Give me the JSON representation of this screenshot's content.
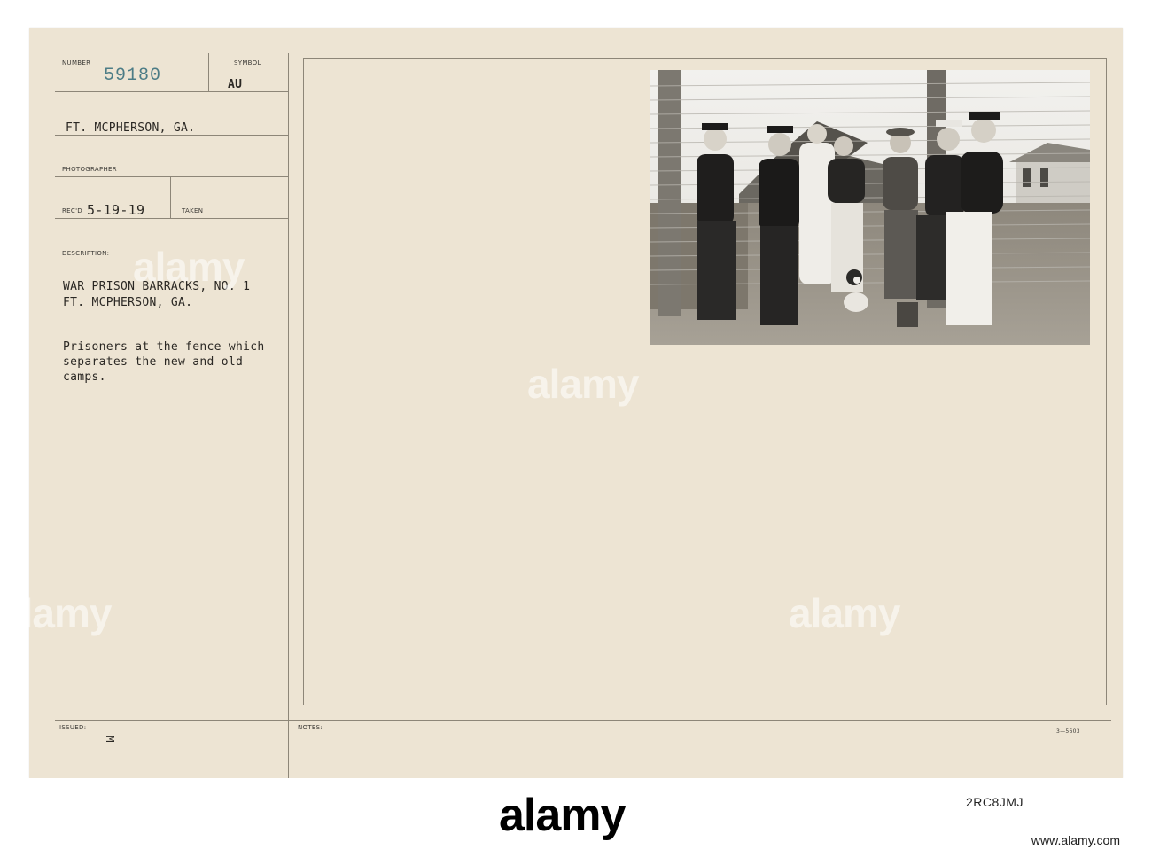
{
  "card": {
    "number_label": "NUMBER",
    "number_value": "59180",
    "symbol_label": "SYMBOL",
    "symbol_value": "AU",
    "location": "FT. MCPHERSON, GA.",
    "photographer_label": "PHOTOGRAPHER",
    "recd_label": "REC'D",
    "recd_value": "5-19-19",
    "taken_label": "TAKEN",
    "description_label": "DESCRIPTION:",
    "description_lines": [
      "WAR PRISON BARRACKS, NO. 1",
      "FT. MCPHERSON, GA."
    ],
    "caption_lines": [
      "Prisoners at the fence which",
      "separates the new and old",
      "camps."
    ],
    "issued_label": "ISSUED:",
    "issued_mark": "M",
    "notes_label": "NOTES:",
    "form_code": "3—5603"
  },
  "watermark": {
    "text": "alamy",
    "footer_code": "2RC8JMJ",
    "footer_url": "www.alamy.com"
  }
}
